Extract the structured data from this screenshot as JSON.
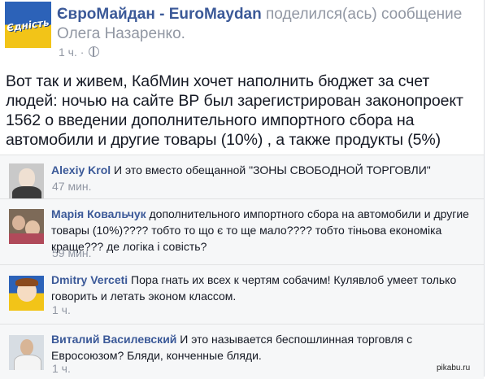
{
  "post": {
    "page_logo_text": "Єдність",
    "page_name": "ЄвроМайдан - EuroMaydan",
    "shared_text": " поделился(ась) сообщение Олега Назаренко.",
    "time": "1 ч.",
    "separator": " · ",
    "privacy_icon": "globe-icon",
    "body": "Вот так и живем, КабМин хочет наполнить бюджет за счет людей: ночью на сайте ВР был зарегистрирован законопроект 1562 о введении дополнительного импортного сбора на автомобили и другие товары (10%) , а также продукты (5%)"
  },
  "comments": [
    {
      "author": "Alexiy Krol",
      "text": " И это вместо обещанной \"ЗОНЫ СВОБОДНОЙ ТОРГОВЛИ\"",
      "time": "47 мин."
    },
    {
      "author": "Марія Ковальчук",
      "text": " дополнительного импортного сбора на автомобили и другие товары (10%)???? тобто то що є то ще мало???? тобто тіньова економіка краще??? де логіка і совість?",
      "time": "59 мин."
    },
    {
      "author": "Dmitry Verceti",
      "text": " Пора гнать их всех к чертям собачим! Кулявлоб умеет только говорить и летать эконом классом.",
      "time": "1 ч."
    },
    {
      "author": "Виталий Василевский",
      "text": " И это называется беспошлинная торговля с Евросоюзом? Бляди, конченные бляди.",
      "time": "1 ч."
    }
  ],
  "watermark": "pikabu.ru"
}
